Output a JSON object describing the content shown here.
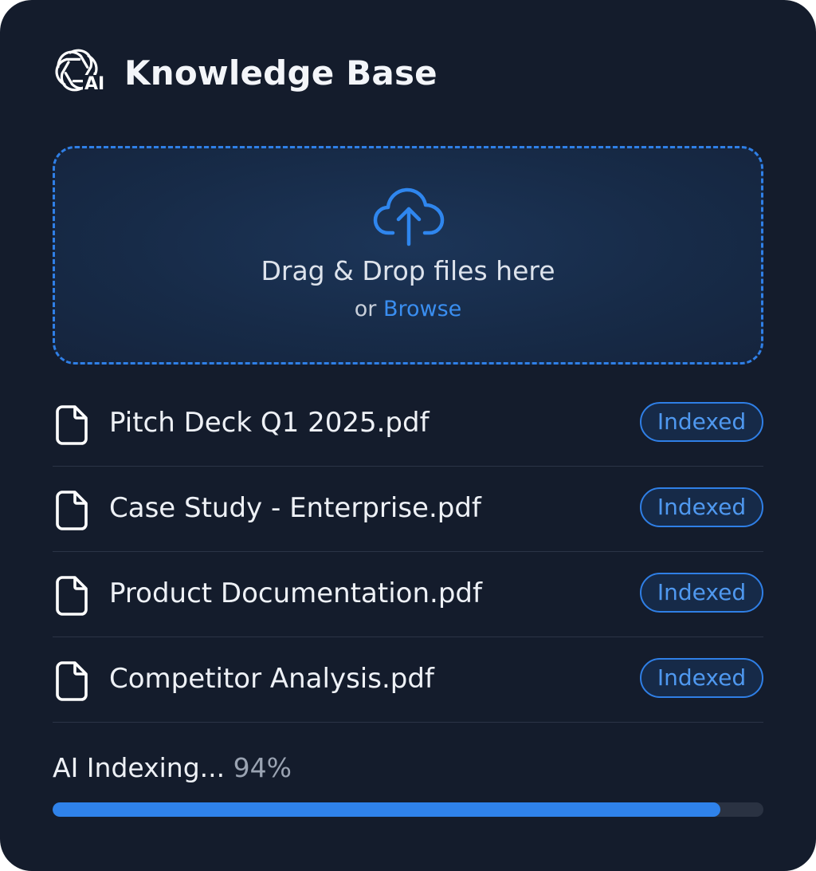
{
  "header": {
    "logo_text": "AI",
    "title": "Knowledge Base"
  },
  "dropzone": {
    "title": "Drag & Drop files here",
    "or_text": "or",
    "browse_label": "Browse",
    "icon": "cloud-upload-icon"
  },
  "files": [
    {
      "name": "Pitch Deck Q1 2025.pdf",
      "status": "Indexed",
      "icon": "file-icon"
    },
    {
      "name": "Case Study - Enterprise.pdf",
      "status": "Indexed",
      "icon": "file-icon"
    },
    {
      "name": "Product Documentation.pdf",
      "status": "Indexed",
      "icon": "file-icon"
    },
    {
      "name": "Competitor Analysis.pdf",
      "status": "Indexed",
      "icon": "file-icon"
    }
  ],
  "progress": {
    "label": "AI Indexing...",
    "percent_text": "94%",
    "value": 94
  },
  "colors": {
    "background": "#141c2c",
    "accent": "#2f7fe6",
    "text": "#eef1f6",
    "muted": "#9aa3b2"
  }
}
